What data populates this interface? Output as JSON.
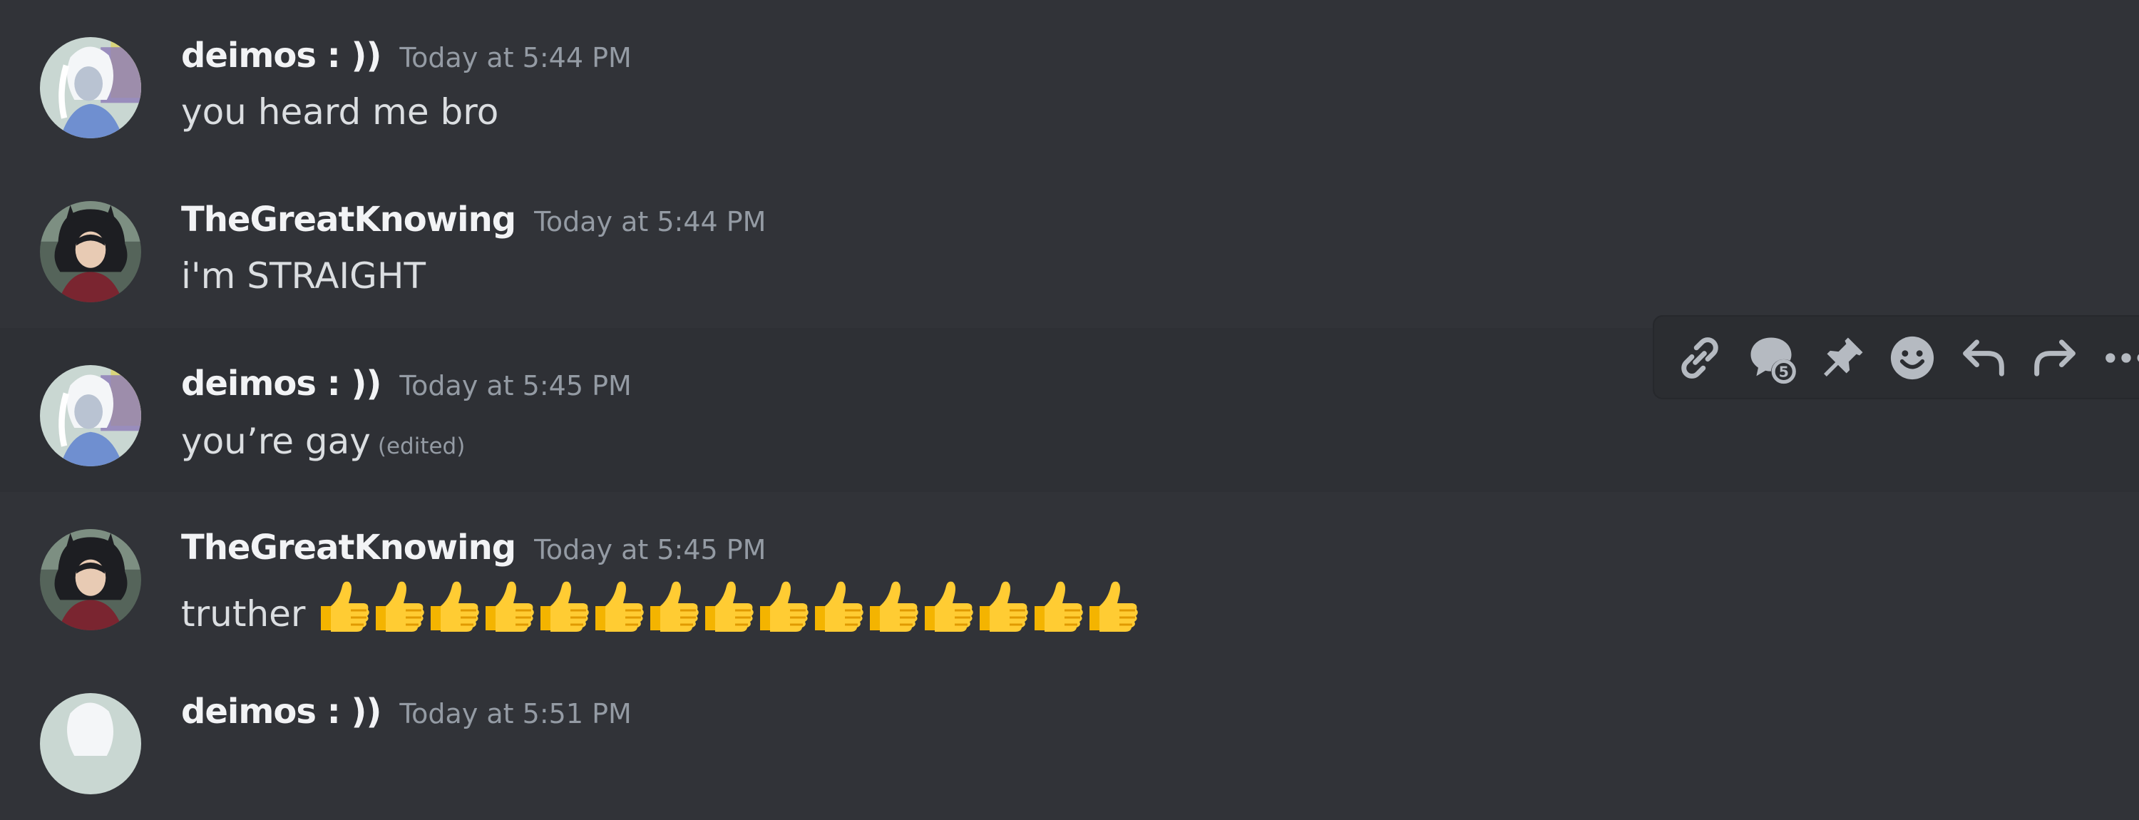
{
  "messages": [
    {
      "username": "deimos : ))",
      "timestamp": "Today at 5:44 PM",
      "content": "you heard me bro",
      "avatar": "white-haired-character-avatar"
    },
    {
      "username": "TheGreatKnowing",
      "timestamp": "Today at 5:44 PM",
      "content": "i'm STRAIGHT",
      "avatar": "dark-haired-character-avatar"
    },
    {
      "username": "deimos : ))",
      "timestamp": "Today at 5:45 PM",
      "content": "you’re gay",
      "edited_label": "(edited)",
      "avatar": "white-haired-character-avatar"
    },
    {
      "username": "TheGreatKnowing",
      "timestamp": "Today at 5:45 PM",
      "content": "truther",
      "emoji": "thumbs-up",
      "emoji_count": 15,
      "avatar": "dark-haired-character-avatar"
    },
    {
      "username": "deimos : ))",
      "timestamp": "Today at 5:51 PM",
      "avatar": "white-haired-character-avatar"
    }
  ],
  "toolbar": {
    "icons": [
      "link-icon",
      "create-thread-icon",
      "pin-icon",
      "add-reaction-icon",
      "reply-icon",
      "forward-icon",
      "more-options-icon"
    ]
  },
  "colors": {
    "background": "#313338",
    "hover_background": "#2e3035",
    "username": "#f2f3f5",
    "timestamp": "#949ba4",
    "text": "#dbdee1",
    "toolbar_background": "#2b2d31"
  }
}
